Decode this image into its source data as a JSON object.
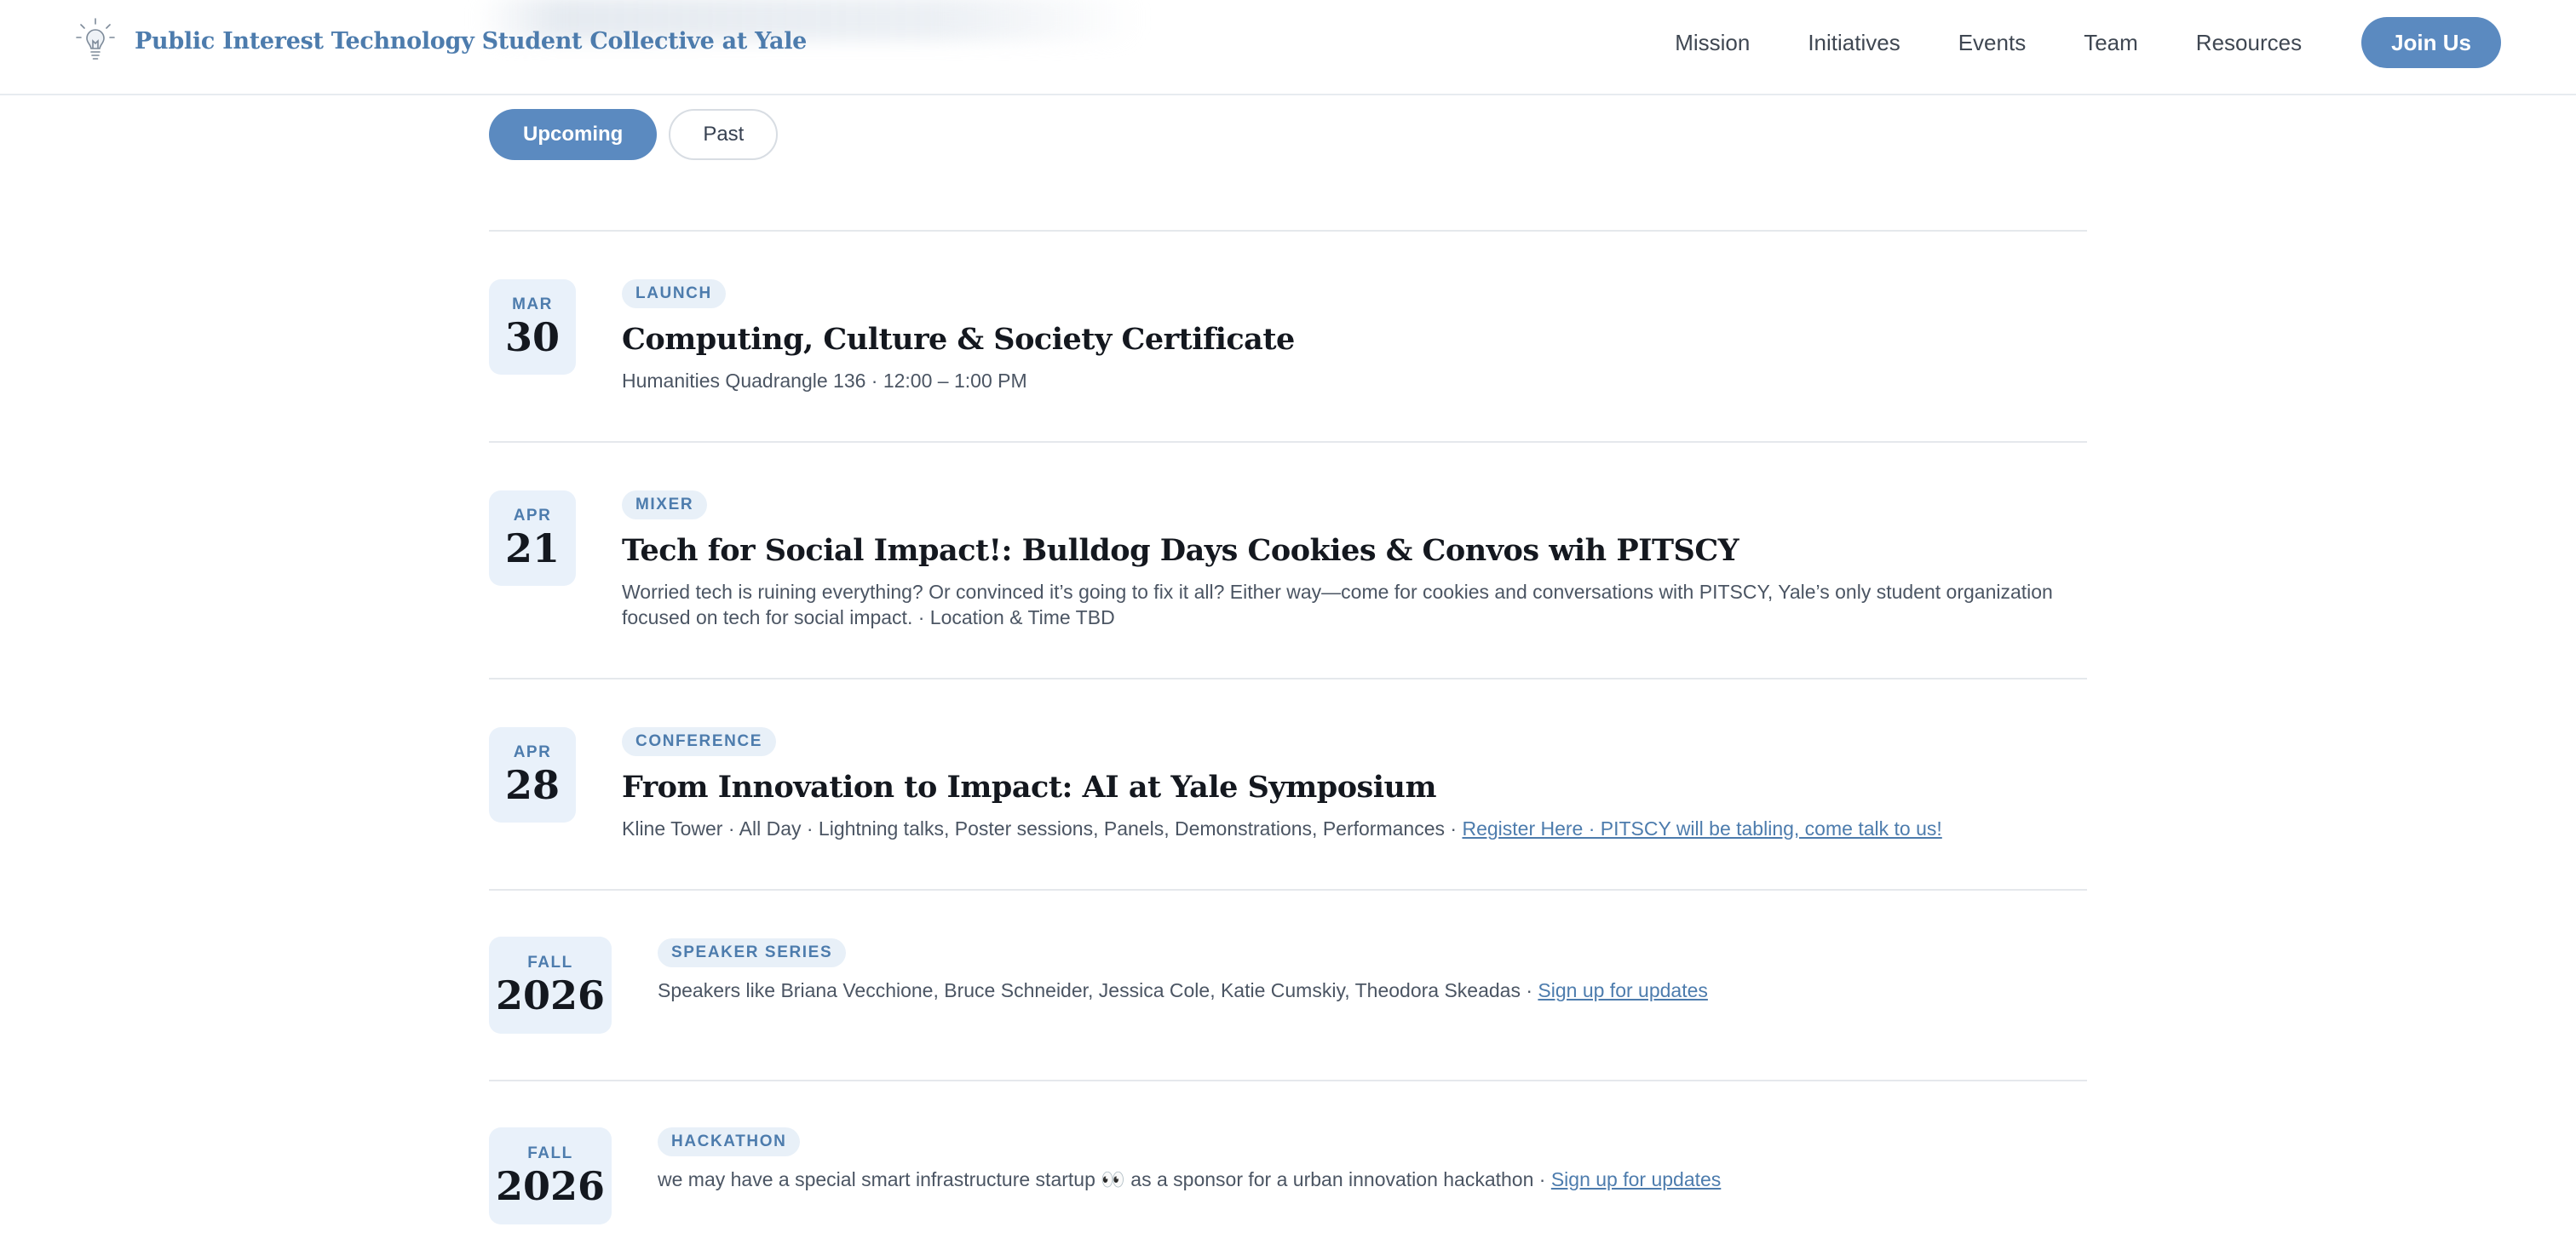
{
  "header": {
    "brand_name": "Public Interest Technology Student Collective at Yale",
    "brand_icon": "lightbulb-icon",
    "nav": [
      "Mission",
      "Initiatives",
      "Events",
      "Team",
      "Resources"
    ],
    "join_label": "Join Us"
  },
  "tabs": {
    "upcoming": "Upcoming",
    "past": "Past"
  },
  "colors": {
    "accent": "#5b8ac0",
    "brand_text": "#4d7cad",
    "tag_bg": "#e8f0f8"
  },
  "events": [
    {
      "date_top": "MAR",
      "date_bottom": "30",
      "tag": "LAUNCH",
      "title": "Computing, Culture & Society Certificate",
      "desc": "Humanities Quadrangle 136 · 12:00 – 1:00 PM"
    },
    {
      "date_top": "APR",
      "date_bottom": "21",
      "tag": "MIXER",
      "title": "Tech for Social Impact!: Bulldog Days Cookies & Convos wih PITSCY",
      "desc": "Worried tech is ruining everything? Or convinced it’s going to fix it all? Either way—come for cookies and conversations with PITSCY, Yale’s only student organization focused on tech for social impact. · Location & Time TBD"
    },
    {
      "date_top": "APR",
      "date_bottom": "28",
      "tag": "CONFERENCE",
      "title": "From Innovation to Impact: AI at Yale Symposium",
      "desc": "Kline Tower · All Day · Lightning talks, Poster sessions, Panels, Demonstrations, Performances · ",
      "link": "Register Here · PITSCY will be tabling, come talk to us!"
    },
    {
      "date_top": "FALL",
      "date_bottom": "2026",
      "tag": "SPEAKER SERIES",
      "desc": "Speakers like Briana Vecchione, Bruce Schneider, Jessica Cole, Katie Cumskiy, Theodora Skeadas · ",
      "link": "Sign up for updates"
    },
    {
      "date_top": "FALL",
      "date_bottom": "2026",
      "tag": "HACKATHON",
      "desc": "we may have a special smart infrastructure startup 👀 as a sponsor for a urban innovation hackathon · ",
      "link": "Sign up for updates"
    }
  ]
}
